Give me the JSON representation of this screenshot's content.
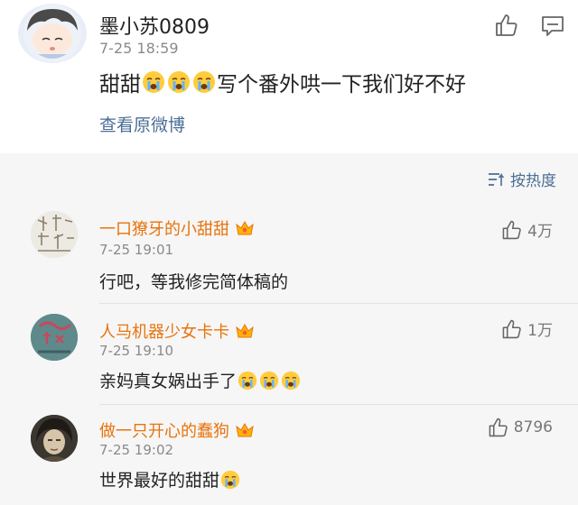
{
  "post": {
    "author": "墨小苏0809",
    "time": "7-25 18:59",
    "text_prefix": "甜甜",
    "text_suffix": "写个番外哄一下我们好不好",
    "emoji_icon": "crying-face-icon",
    "view_original": "查看原微博"
  },
  "sort": {
    "label": "按热度"
  },
  "comments": [
    {
      "name": "一口獠牙的小甜甜",
      "time": "7-25 19:01",
      "text": "行吧，等我修完简体稿的",
      "likes": "4万",
      "emojis": 0
    },
    {
      "name": "人马机器少女卡卡",
      "time": "7-25 19:10",
      "text": "亲妈真女娲出手了",
      "likes": "1万",
      "emojis": 3
    },
    {
      "name": "做一只开心的蠢狗",
      "time": "7-25 19:02",
      "text": "世界最好的甜甜",
      "likes": "8796",
      "emojis": 1
    }
  ],
  "colors": {
    "link": "#4b6e96",
    "username": "#e8730c",
    "time": "#8a8a8a"
  }
}
